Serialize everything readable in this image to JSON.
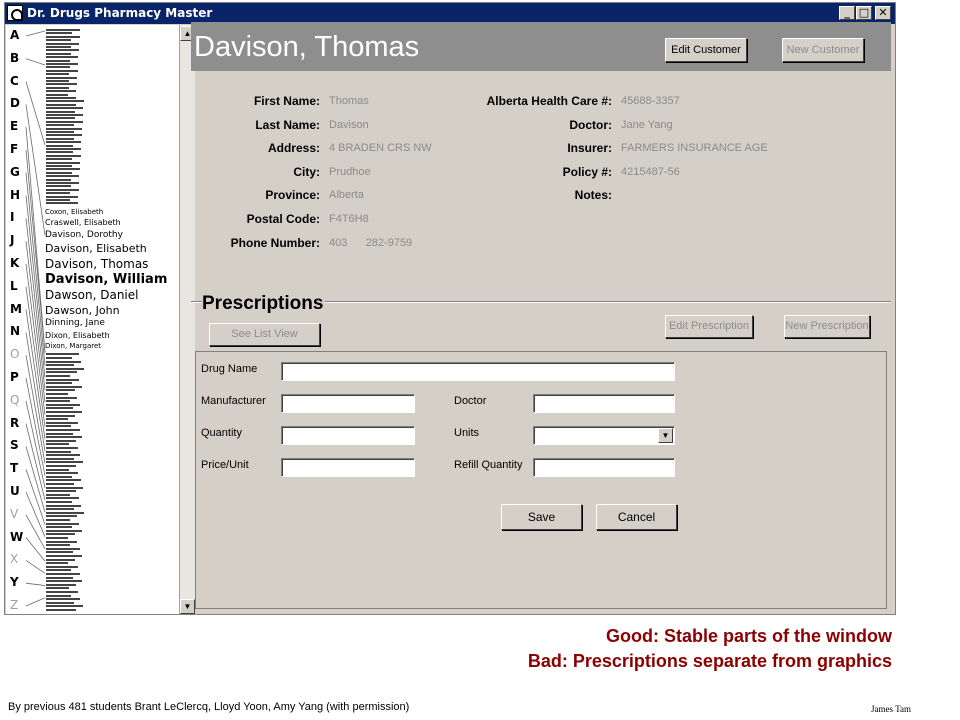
{
  "window": {
    "title": "Dr. Drugs Pharmacy Master",
    "buttons": {
      "minimize": "_",
      "maximize": "□",
      "close": "✕"
    }
  },
  "sidebar": {
    "letters": [
      "A",
      "B",
      "C",
      "D",
      "E",
      "F",
      "G",
      "H",
      "I",
      "J",
      "K",
      "L",
      "M",
      "N",
      "O",
      "P",
      "Q",
      "R",
      "S",
      "T",
      "U",
      "V",
      "W",
      "X",
      "Y",
      "Z"
    ],
    "dim_letters": [
      "O",
      "Q",
      "V",
      "X",
      "Z"
    ],
    "names": [
      {
        "text": "Coxon, Elisabeth",
        "size": 7
      },
      {
        "text": "Craswell, Elisabeth",
        "size": 8
      },
      {
        "text": "Davison, Dorothy",
        "size": 9
      },
      {
        "text": "Davison, Elisabeth",
        "size": 11
      },
      {
        "text": "Davison, Thomas",
        "size": 12
      },
      {
        "text": "Davison, William",
        "size": 13,
        "bold": true
      },
      {
        "text": "Dawson, Daniel",
        "size": 12
      },
      {
        "text": "Dawson, John",
        "size": 11
      },
      {
        "text": "Dinning, Jane",
        "size": 9
      },
      {
        "text": "Dixon, Elisabeth",
        "size": 8
      },
      {
        "text": "Dixon, Margaret",
        "size": 7
      }
    ],
    "scroll": {
      "up": "▲",
      "down": "▼"
    }
  },
  "customer": {
    "name": "Davison, Thomas",
    "edit_button": "Edit Customer",
    "new_button": "New Customer",
    "fields_left": [
      {
        "label": "First Name:",
        "value": "Thomas"
      },
      {
        "label": "Last Name:",
        "value": "Davison"
      },
      {
        "label": "Address:",
        "value": "4 BRADEN CRS NW"
      },
      {
        "label": "City:",
        "value": "Prudhoe"
      },
      {
        "label": "Province:",
        "value": "Alberta"
      },
      {
        "label": "Postal Code:",
        "value": "F4T6H8"
      },
      {
        "label": "Phone Number:",
        "value": "403      282-9759"
      }
    ],
    "fields_right": [
      {
        "label": "Alberta Health Care #:",
        "value": "45688-3357"
      },
      {
        "label": "Doctor:",
        "value": "Jane Yang"
      },
      {
        "label": "Insurer:",
        "value": "FARMERS INSURANCE AGE"
      },
      {
        "label": "Policy #:",
        "value": "4215487-56"
      },
      {
        "label": "Notes:",
        "value": ""
      }
    ]
  },
  "prescriptions": {
    "title": "Prescriptions",
    "see_list_button": "See List View",
    "edit_button": "Edit Prescription",
    "new_button": "New Prescription",
    "form": {
      "drug_name": {
        "label": "Drug Name",
        "value": ""
      },
      "manufacturer": {
        "label": "Manufacturer",
        "value": ""
      },
      "doctor": {
        "label": "Doctor",
        "value": ""
      },
      "quantity": {
        "label": "Quantity",
        "value": ""
      },
      "units": {
        "label": "Units",
        "value": ""
      },
      "price_unit": {
        "label": "Price/Unit",
        "value": ""
      },
      "refill_quantity": {
        "label": "Refill Quantity",
        "value": ""
      }
    },
    "save_button": "Save",
    "cancel_button": "Cancel"
  },
  "annotation": {
    "good": "Good: Stable parts of the window",
    "bad": "Bad: Prescriptions separate from graphics"
  },
  "footer": {
    "credit": "By previous 481 students Brant LeClercq, Lloyd Yoon, Amy Yang (with permission)",
    "author": "James Tam"
  },
  "colors": {
    "titlebar": "#0a246a",
    "window_face": "#d4d0c8",
    "header_strip": "#8e8e8e",
    "caption": "#8b0000",
    "value_text": "#8a8a8a"
  }
}
